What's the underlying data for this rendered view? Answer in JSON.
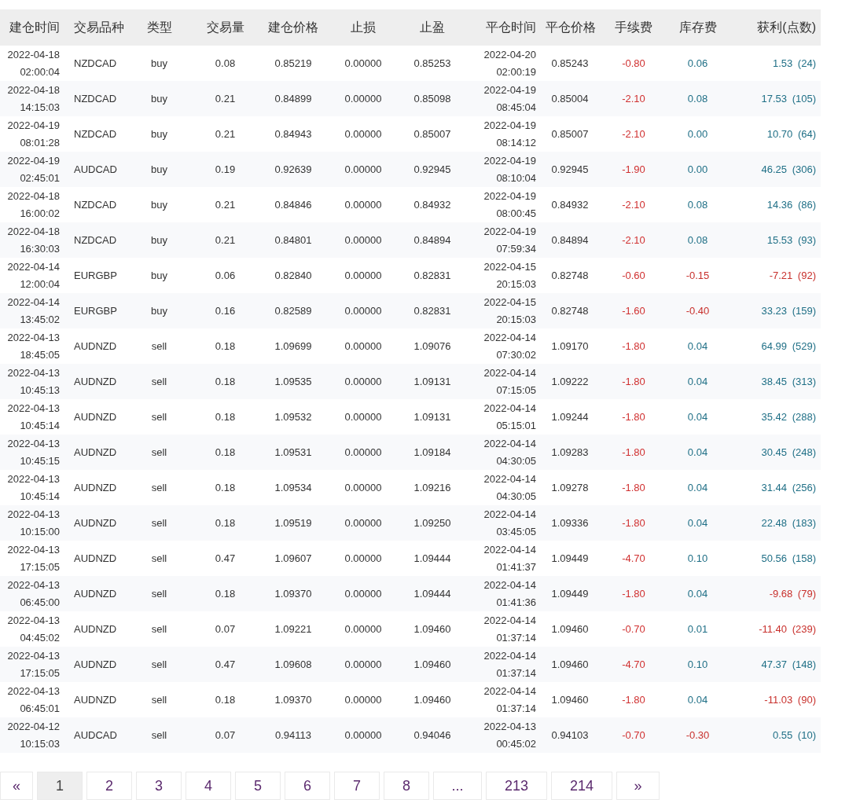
{
  "table": {
    "columns": [
      "建仓时间",
      "交易品种",
      "类型",
      "交易量",
      "建仓价格",
      "止损",
      "止盈",
      "平仓时间",
      "平仓价格",
      "手续费",
      "库存费",
      "获利(点数)"
    ],
    "rows": [
      {
        "open_time": "2022-04-18 02:00:04",
        "symbol": "NZDCAD",
        "type": "buy",
        "volume": "0.08",
        "open_price": "0.85219",
        "stop_loss": "0.00000",
        "take_profit": "0.85253",
        "close_time": "2022-04-20 02:00:19",
        "close_price": "0.85243",
        "commission": "-0.80",
        "swap": {
          "text": "0.06",
          "color": "#1f6f86"
        },
        "profit": {
          "text": "1.53 (24)",
          "color": "#1f6f86"
        }
      },
      {
        "open_time": "2022-04-18 14:15:03",
        "symbol": "NZDCAD",
        "type": "buy",
        "volume": "0.21",
        "open_price": "0.84899",
        "stop_loss": "0.00000",
        "take_profit": "0.85098",
        "close_time": "2022-04-19 08:45:04",
        "close_price": "0.85004",
        "commission": "-2.10",
        "swap": {
          "text": "0.08",
          "color": "#1f6f86"
        },
        "profit": {
          "text": "17.53 (105)",
          "color": "#1f6f86"
        }
      },
      {
        "open_time": "2022-04-19 08:01:28",
        "symbol": "NZDCAD",
        "type": "buy",
        "volume": "0.21",
        "open_price": "0.84943",
        "stop_loss": "0.00000",
        "take_profit": "0.85007",
        "close_time": "2022-04-19 08:14:12",
        "close_price": "0.85007",
        "commission": "-2.10",
        "swap": {
          "text": "0.00",
          "color": "#1f6f86"
        },
        "profit": {
          "text": "10.70 (64)",
          "color": "#1f6f86"
        }
      },
      {
        "open_time": "2022-04-19 02:45:01",
        "symbol": "AUDCAD",
        "type": "buy",
        "volume": "0.19",
        "open_price": "0.92639",
        "stop_loss": "0.00000",
        "take_profit": "0.92945",
        "close_time": "2022-04-19 08:10:04",
        "close_price": "0.92945",
        "commission": "-1.90",
        "swap": {
          "text": "0.00",
          "color": "#1f6f86"
        },
        "profit": {
          "text": "46.25 (306)",
          "color": "#1f6f86"
        }
      },
      {
        "open_time": "2022-04-18 16:00:02",
        "symbol": "NZDCAD",
        "type": "buy",
        "volume": "0.21",
        "open_price": "0.84846",
        "stop_loss": "0.00000",
        "take_profit": "0.84932",
        "close_time": "2022-04-19 08:00:45",
        "close_price": "0.84932",
        "commission": "-2.10",
        "swap": {
          "text": "0.08",
          "color": "#1f6f86"
        },
        "profit": {
          "text": "14.36 (86)",
          "color": "#1f6f86"
        }
      },
      {
        "open_time": "2022-04-18 16:30:03",
        "symbol": "NZDCAD",
        "type": "buy",
        "volume": "0.21",
        "open_price": "0.84801",
        "stop_loss": "0.00000",
        "take_profit": "0.84894",
        "close_time": "2022-04-19 07:59:34",
        "close_price": "0.84894",
        "commission": "-2.10",
        "swap": {
          "text": "0.08",
          "color": "#1f6f86"
        },
        "profit": {
          "text": "15.53 (93)",
          "color": "#1f6f86"
        }
      },
      {
        "open_time": "2022-04-14 12:00:04",
        "symbol": "EURGBP",
        "type": "buy",
        "volume": "0.06",
        "open_price": "0.82840",
        "stop_loss": "0.00000",
        "take_profit": "0.82831",
        "close_time": "2022-04-15 20:15:03",
        "close_price": "0.82748",
        "commission": "-0.60",
        "swap": {
          "text": "-0.15",
          "color": "#c8302c"
        },
        "profit": {
          "text": "-7.21 (92)",
          "color": "#c8302c"
        }
      },
      {
        "open_time": "2022-04-14 13:45:02",
        "symbol": "EURGBP",
        "type": "buy",
        "volume": "0.16",
        "open_price": "0.82589",
        "stop_loss": "0.00000",
        "take_profit": "0.82831",
        "close_time": "2022-04-15 20:15:03",
        "close_price": "0.82748",
        "commission": "-1.60",
        "swap": {
          "text": "-0.40",
          "color": "#c8302c"
        },
        "profit": {
          "text": "33.23 (159)",
          "color": "#1f6f86"
        }
      },
      {
        "open_time": "2022-04-13 18:45:05",
        "symbol": "AUDNZD",
        "type": "sell",
        "volume": "0.18",
        "open_price": "1.09699",
        "stop_loss": "0.00000",
        "take_profit": "1.09076",
        "close_time": "2022-04-14 07:30:02",
        "close_price": "1.09170",
        "commission": "-1.80",
        "swap": {
          "text": "0.04",
          "color": "#1f6f86"
        },
        "profit": {
          "text": "64.99 (529)",
          "color": "#1f6f86"
        }
      },
      {
        "open_time": "2022-04-13 10:45:13",
        "symbol": "AUDNZD",
        "type": "sell",
        "volume": "0.18",
        "open_price": "1.09535",
        "stop_loss": "0.00000",
        "take_profit": "1.09131",
        "close_time": "2022-04-14 07:15:05",
        "close_price": "1.09222",
        "commission": "-1.80",
        "swap": {
          "text": "0.04",
          "color": "#1f6f86"
        },
        "profit": {
          "text": "38.45 (313)",
          "color": "#1f6f86"
        }
      },
      {
        "open_time": "2022-04-13 10:45:14",
        "symbol": "AUDNZD",
        "type": "sell",
        "volume": "0.18",
        "open_price": "1.09532",
        "stop_loss": "0.00000",
        "take_profit": "1.09131",
        "close_time": "2022-04-14 05:15:01",
        "close_price": "1.09244",
        "commission": "-1.80",
        "swap": {
          "text": "0.04",
          "color": "#1f6f86"
        },
        "profit": {
          "text": "35.42 (288)",
          "color": "#1f6f86"
        }
      },
      {
        "open_time": "2022-04-13 10:45:15",
        "symbol": "AUDNZD",
        "type": "sell",
        "volume": "0.18",
        "open_price": "1.09531",
        "stop_loss": "0.00000",
        "take_profit": "1.09184",
        "close_time": "2022-04-14 04:30:05",
        "close_price": "1.09283",
        "commission": "-1.80",
        "swap": {
          "text": "0.04",
          "color": "#1f6f86"
        },
        "profit": {
          "text": "30.45 (248)",
          "color": "#1f6f86"
        }
      },
      {
        "open_time": "2022-04-13 10:45:14",
        "symbol": "AUDNZD",
        "type": "sell",
        "volume": "0.18",
        "open_price": "1.09534",
        "stop_loss": "0.00000",
        "take_profit": "1.09216",
        "close_time": "2022-04-14 04:30:05",
        "close_price": "1.09278",
        "commission": "-1.80",
        "swap": {
          "text": "0.04",
          "color": "#1f6f86"
        },
        "profit": {
          "text": "31.44 (256)",
          "color": "#1f6f86"
        }
      },
      {
        "open_time": "2022-04-13 10:15:00",
        "symbol": "AUDNZD",
        "type": "sell",
        "volume": "0.18",
        "open_price": "1.09519",
        "stop_loss": "0.00000",
        "take_profit": "1.09250",
        "close_time": "2022-04-14 03:45:05",
        "close_price": "1.09336",
        "commission": "-1.80",
        "swap": {
          "text": "0.04",
          "color": "#1f6f86"
        },
        "profit": {
          "text": "22.48 (183)",
          "color": "#1f6f86"
        }
      },
      {
        "open_time": "2022-04-13 17:15:05",
        "symbol": "AUDNZD",
        "type": "sell",
        "volume": "0.47",
        "open_price": "1.09607",
        "stop_loss": "0.00000",
        "take_profit": "1.09444",
        "close_time": "2022-04-14 01:41:37",
        "close_price": "1.09449",
        "commission": "-4.70",
        "swap": {
          "text": "0.10",
          "color": "#1f6f86"
        },
        "profit": {
          "text": "50.56 (158)",
          "color": "#1f6f86"
        }
      },
      {
        "open_time": "2022-04-13 06:45:00",
        "symbol": "AUDNZD",
        "type": "sell",
        "volume": "0.18",
        "open_price": "1.09370",
        "stop_loss": "0.00000",
        "take_profit": "1.09444",
        "close_time": "2022-04-14 01:41:36",
        "close_price": "1.09449",
        "commission": "-1.80",
        "swap": {
          "text": "0.04",
          "color": "#1f6f86"
        },
        "profit": {
          "text": "-9.68 (79)",
          "color": "#c8302c"
        }
      },
      {
        "open_time": "2022-04-13 04:45:02",
        "symbol": "AUDNZD",
        "type": "sell",
        "volume": "0.07",
        "open_price": "1.09221",
        "stop_loss": "0.00000",
        "take_profit": "1.09460",
        "close_time": "2022-04-14 01:37:14",
        "close_price": "1.09460",
        "commission": "-0.70",
        "swap": {
          "text": "0.01",
          "color": "#1f6f86"
        },
        "profit": {
          "text": "-11.40 (239)",
          "color": "#c8302c"
        }
      },
      {
        "open_time": "2022-04-13 17:15:05",
        "symbol": "AUDNZD",
        "type": "sell",
        "volume": "0.47",
        "open_price": "1.09608",
        "stop_loss": "0.00000",
        "take_profit": "1.09460",
        "close_time": "2022-04-14 01:37:14",
        "close_price": "1.09460",
        "commission": "-4.70",
        "swap": {
          "text": "0.10",
          "color": "#1f6f86"
        },
        "profit": {
          "text": "47.37 (148)",
          "color": "#1f6f86"
        }
      },
      {
        "open_time": "2022-04-13 06:45:01",
        "symbol": "AUDNZD",
        "type": "sell",
        "volume": "0.18",
        "open_price": "1.09370",
        "stop_loss": "0.00000",
        "take_profit": "1.09460",
        "close_time": "2022-04-14 01:37:14",
        "close_price": "1.09460",
        "commission": "-1.80",
        "swap": {
          "text": "0.04",
          "color": "#1f6f86"
        },
        "profit": {
          "text": "-11.03 (90)",
          "color": "#c8302c"
        }
      },
      {
        "open_time": "2022-04-12 10:15:03",
        "symbol": "AUDCAD",
        "type": "sell",
        "volume": "0.07",
        "open_price": "0.94113",
        "stop_loss": "0.00000",
        "take_profit": "0.94046",
        "close_time": "2022-04-13 00:45:02",
        "close_price": "0.94103",
        "commission": "-0.70",
        "swap": {
          "text": "-0.30",
          "color": "#c8302c"
        },
        "profit": {
          "text": "0.55 (10)",
          "color": "#1f6f86"
        }
      }
    ]
  },
  "pagination": [
    {
      "label": "«",
      "selected": false
    },
    {
      "label": "1",
      "selected": true
    },
    {
      "label": "2",
      "selected": false
    },
    {
      "label": "3",
      "selected": false
    },
    {
      "label": "4",
      "selected": false
    },
    {
      "label": "5",
      "selected": false
    },
    {
      "label": "6",
      "selected": false
    },
    {
      "label": "7",
      "selected": false
    },
    {
      "label": "8",
      "selected": false
    },
    {
      "label": "...",
      "selected": false
    },
    {
      "label": "213",
      "selected": false
    },
    {
      "label": "214",
      "selected": false
    },
    {
      "label": "»",
      "selected": false
    }
  ]
}
